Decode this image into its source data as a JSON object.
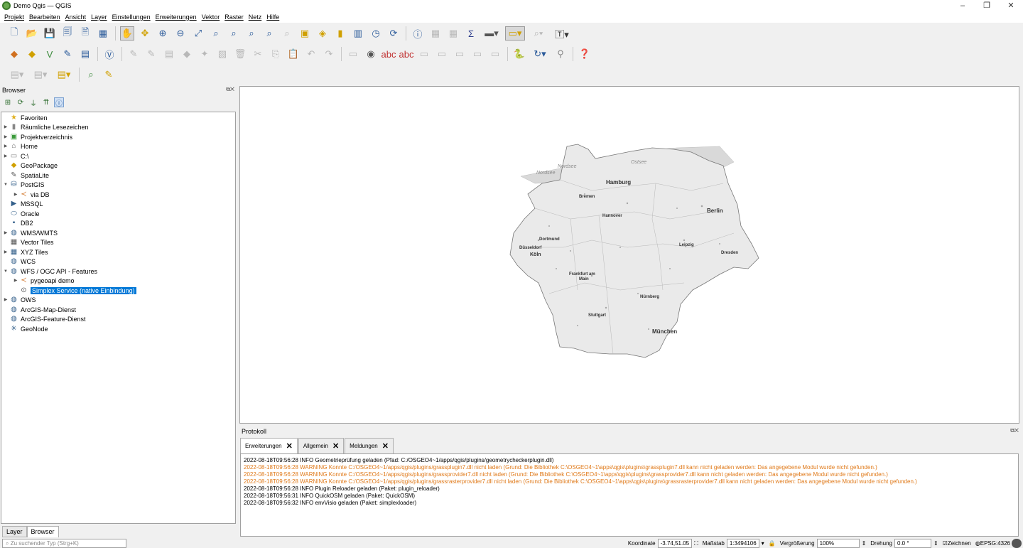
{
  "window": {
    "title": "Demo Qgis — QGIS",
    "controls": [
      "–",
      "❐",
      "✕"
    ]
  },
  "menu": [
    "Projekt",
    "Bearbeiten",
    "Ansicht",
    "Layer",
    "Einstellungen",
    "Erweiterungen",
    "Vektor",
    "Raster",
    "Netz",
    "Hilfe"
  ],
  "browser": {
    "title": "Browser",
    "items": [
      {
        "label": "Favoriten",
        "icon": "star-icon",
        "expand": ""
      },
      {
        "label": "Räumliche Lesezeichen",
        "icon": "bookmark-icon",
        "expand": "▶"
      },
      {
        "label": "Projektverzeichnis",
        "icon": "project-folder-icon",
        "expand": "▶"
      },
      {
        "label": "Home",
        "icon": "home-folder-icon",
        "expand": "▶"
      },
      {
        "label": "C:\\",
        "icon": "drive-icon",
        "expand": "▶"
      },
      {
        "label": "GeoPackage",
        "icon": "geopackage-icon",
        "expand": ""
      },
      {
        "label": "SpatiaLite",
        "icon": "spatialite-icon",
        "expand": ""
      },
      {
        "label": "PostGIS",
        "icon": "postgis-icon",
        "expand": "▼"
      },
      {
        "label": "via DB",
        "icon": "connection-icon",
        "expand": "▶",
        "indent": 1
      },
      {
        "label": "MSSQL",
        "icon": "mssql-icon",
        "expand": ""
      },
      {
        "label": "Oracle",
        "icon": "oracle-icon",
        "expand": ""
      },
      {
        "label": "DB2",
        "icon": "db2-icon",
        "expand": ""
      },
      {
        "label": "WMS/WMTS",
        "icon": "wms-icon",
        "expand": "▶"
      },
      {
        "label": "Vector Tiles",
        "icon": "vector-tiles-icon",
        "expand": ""
      },
      {
        "label": "XYZ Tiles",
        "icon": "xyz-tiles-icon",
        "expand": "▶"
      },
      {
        "label": "WCS",
        "icon": "wcs-icon",
        "expand": ""
      },
      {
        "label": "WFS / OGC API - Features",
        "icon": "wfs-icon",
        "expand": "▼"
      },
      {
        "label": "pygeoapi demo",
        "icon": "connection-icon",
        "expand": "▶",
        "indent": 1
      },
      {
        "label": "Simplex Service (native Einbindung)",
        "icon": "service-icon",
        "expand": "",
        "indent": 1,
        "selected": true
      },
      {
        "label": "OWS",
        "icon": "ows-icon",
        "expand": "▶"
      },
      {
        "label": "ArcGIS-Map-Dienst",
        "icon": "arcgis-map-icon",
        "expand": ""
      },
      {
        "label": "ArcGIS-Feature-Dienst",
        "icon": "arcgis-feature-icon",
        "expand": ""
      },
      {
        "label": "GeoNode",
        "icon": "geonode-icon",
        "expand": ""
      }
    ]
  },
  "bottom_tabs": [
    "Layer",
    "Browser"
  ],
  "map": {
    "labels": [
      "Nordsee",
      "Nordsee",
      "Ostsee",
      "Hamburg",
      "Bremen",
      "Hannover",
      "Berlin",
      "Dortmund",
      "Düsseldorf",
      "Köln",
      "Leipzig",
      "Dresden",
      "Frankfurt am",
      "Main",
      "Nürnberg",
      "Stuttgart",
      "München"
    ]
  },
  "log": {
    "title": "Protokoll",
    "tabs": [
      "Erweiterungen",
      "Allgemein",
      "Meldungen"
    ],
    "lines": [
      {
        "text": "2022-08-18T09:56:28     INFO    Geometrieprüfung geladen (Pfad: C:/OSGEO4~1/apps/qgis/plugins/geometrycheckerplugin.dll)",
        "level": "info"
      },
      {
        "text": "2022-08-18T09:56:28     WARNING    Konnte C:/OSGEO4~1/apps/qgis/plugins/grassplugin7.dll nicht laden (Grund: Die Bibliothek C:\\OSGEO4~1\\apps\\qgis\\plugins\\grassplugin7.dll kann nicht geladen werden: Das angegebene Modul wurde nicht gefunden.)",
        "level": "warning"
      },
      {
        "text": "2022-08-18T09:56:28     WARNING    Konnte C:/OSGEO4~1/apps/qgis/plugins/grassprovider7.dll nicht laden (Grund: Die Bibliothek C:\\OSGEO4~1\\apps\\qgis\\plugins\\grassprovider7.dll kann nicht geladen werden: Das angegebene Modul wurde nicht gefunden.)",
        "level": "warning"
      },
      {
        "text": "2022-08-18T09:56:28     WARNING    Konnte C:/OSGEO4~1/apps/qgis/plugins/grassrasterprovider7.dll nicht laden (Grund: Die Bibliothek C:\\OSGEO4~1\\apps\\qgis\\plugins\\grassrasterprovider7.dll kann nicht geladen werden: Das angegebene Modul wurde nicht gefunden.)",
        "level": "warning"
      },
      {
        "text": "2022-08-18T09:56:28     INFO    Plugin Reloader geladen (Paket: plugin_reloader)",
        "level": "info"
      },
      {
        "text": "2022-08-18T09:56:31     INFO    QuickOSM geladen (Paket: QuickOSM)",
        "level": "info"
      },
      {
        "text": "2022-08-18T09:56:32     INFO    envVisio geladen (Paket: simplexloader)",
        "level": "info"
      }
    ]
  },
  "status": {
    "locator_placeholder": "Zu suchender Typ (Strg+K)",
    "coord_label": "Koordinate",
    "coord_value": "-3.74,51.05",
    "scale_label": "Maßstab",
    "scale_value": "1:3494106",
    "zoom_label": "Vergrößerung",
    "zoom_value": "100%",
    "rotation_label": "Drehung",
    "rotation_value": "0.0 °",
    "render_label": "Zeichnen",
    "crs": "EPSG:4326"
  },
  "colors": {
    "selection": "#0078d7",
    "warning": "#e07a1a"
  }
}
